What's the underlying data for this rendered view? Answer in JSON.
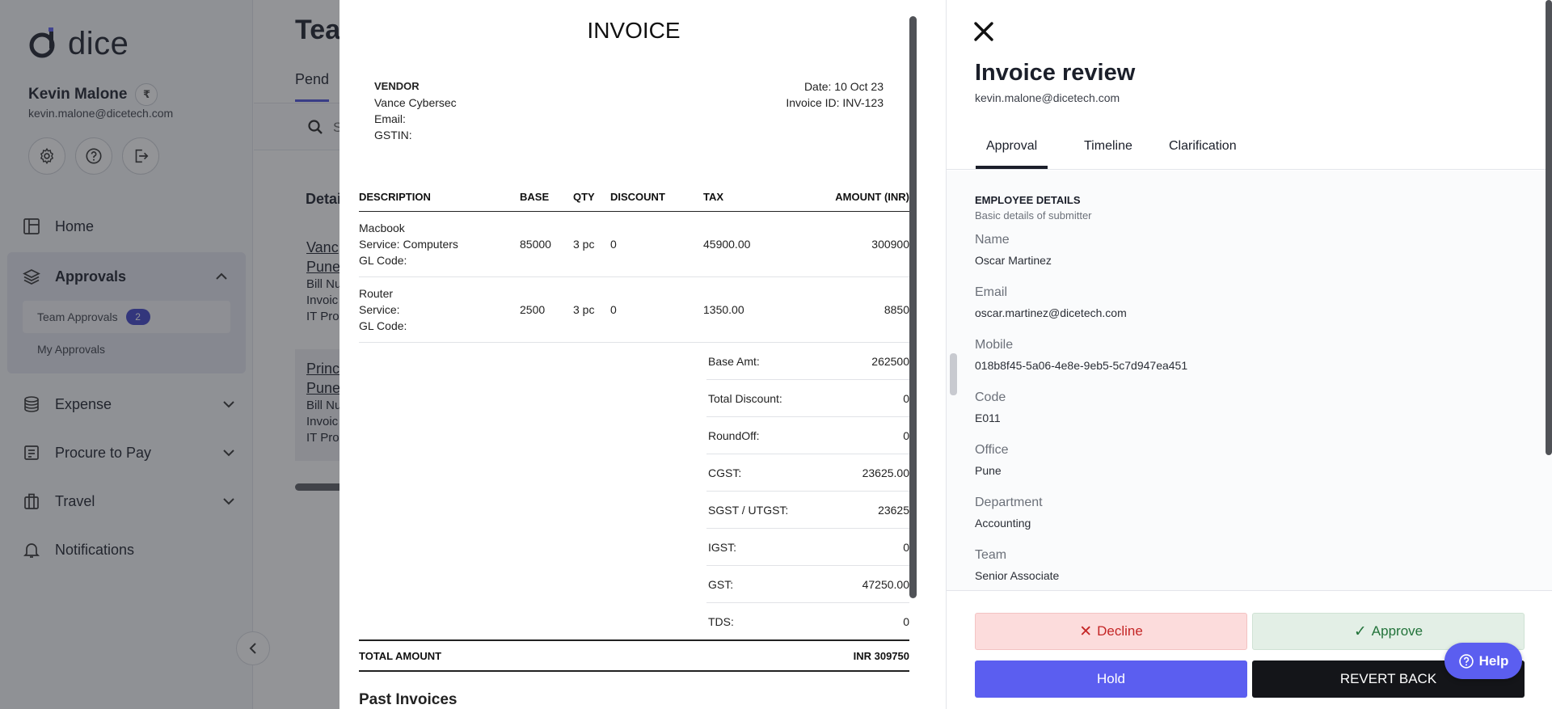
{
  "sidebar": {
    "brand": "dice",
    "user_name": "Kevin Malone",
    "currency_badge": "₹",
    "user_email": "kevin.malone@dicetech.com",
    "icons": [
      "gear-icon",
      "help-circle-icon",
      "logout-icon"
    ],
    "nav": {
      "home": "Home",
      "approvals": "Approvals",
      "team_approvals": "Team Approvals",
      "team_approvals_count": "2",
      "my_approvals": "My Approvals",
      "expense": "Expense",
      "procure_to_pay": "Procure to Pay",
      "travel": "Travel",
      "notifications": "Notifications"
    }
  },
  "page": {
    "title": "Tea",
    "tab": "Pend",
    "search_placeholder": "S",
    "column_head": "Detai",
    "cards": [
      {
        "title_line1": "Vanc",
        "title_line2": "Pune",
        "lines": [
          "Bill Nu",
          "Invoic",
          "IT Pro"
        ]
      },
      {
        "title_line1": "Princ",
        "title_line2": "Pune",
        "lines": [
          "Bill Nu",
          "Invoic",
          "IT Pro"
        ]
      }
    ]
  },
  "invoice": {
    "title": "INVOICE",
    "vendor_label": "VENDOR",
    "vendor_name": "Vance Cybersec",
    "email_label": "Email:",
    "gstin_label": "GSTIN:",
    "date": "Date: 10 Oct 23",
    "invoice_id": "Invoice ID: INV-123",
    "columns": [
      "DESCRIPTION",
      "BASE",
      "QTY",
      "DISCOUNT",
      "TAX",
      "AMOUNT (INR)"
    ],
    "items": [
      {
        "name": "Macbook",
        "service": "Service: Computers",
        "gl": "GL Code:",
        "base": "85000",
        "qty": "3 pc",
        "discount": "0",
        "tax": "45900.00",
        "amount": "300900"
      },
      {
        "name": "Router",
        "service": "Service:",
        "gl": "GL Code:",
        "base": "2500",
        "qty": "3 pc",
        "discount": "0",
        "tax": "1350.00",
        "amount": "8850"
      }
    ],
    "summary": [
      {
        "label": "Base Amt:",
        "value": "262500"
      },
      {
        "label": "Total Discount:",
        "value": "0"
      },
      {
        "label": "RoundOff:",
        "value": "0"
      },
      {
        "label": "CGST:",
        "value": "23625.00"
      },
      {
        "label": "SGST / UTGST:",
        "value": "23625"
      },
      {
        "label": "IGST:",
        "value": "0"
      },
      {
        "label": "GST:",
        "value": "47250.00"
      },
      {
        "label": "TDS:",
        "value": "0"
      }
    ],
    "total_label": "TOTAL AMOUNT",
    "total_value": "INR 309750",
    "past_invoices": "Past Invoices"
  },
  "review": {
    "title": "Invoice review",
    "email": "kevin.malone@dicetech.com",
    "tabs": [
      "Approval",
      "Timeline",
      "Clarification"
    ],
    "section_title": "EMPLOYEE DETAILS",
    "section_sub": "Basic details of submitter",
    "fields": [
      {
        "label": "Name",
        "value": "Oscar Martinez"
      },
      {
        "label": "Email",
        "value": "oscar.martinez@dicetech.com"
      },
      {
        "label": "Mobile",
        "value": "018b8f45-5a06-4e8e-9eb5-5c7d947ea451"
      },
      {
        "label": "Code",
        "value": "E011"
      },
      {
        "label": "Office",
        "value": "Pune"
      },
      {
        "label": "Department",
        "value": "Accounting"
      },
      {
        "label": "Team",
        "value": "Senior Associate"
      }
    ],
    "decline": "Decline",
    "approve": "Approve",
    "hold": "Hold",
    "revert": "REVERT BACK",
    "help": "Help"
  },
  "colors": {
    "accent": "#5b5ef0",
    "decline_bg": "#fcdcdc",
    "decline_text": "#c42525",
    "approve_bg": "#e3efe6",
    "approve_text": "#22733a"
  }
}
